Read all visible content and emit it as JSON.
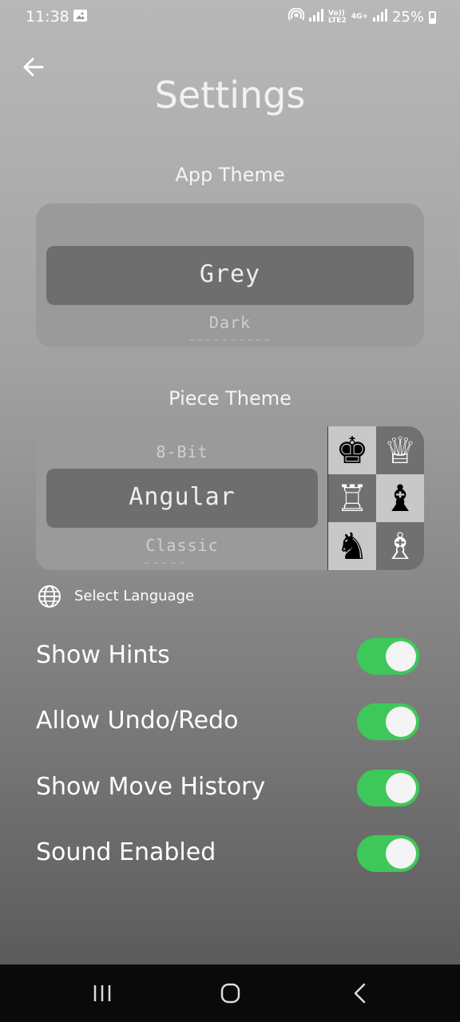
{
  "status_bar": {
    "time": "11:38",
    "network_label_top": "Vo))",
    "network_label_bottom": "LTE2",
    "network_4g": "4G+",
    "battery": "25%"
  },
  "header": {
    "title": "Settings",
    "back_icon": "arrow-left-icon"
  },
  "app_theme": {
    "title": "App Theme",
    "options": [
      "Grey",
      "Dark"
    ],
    "selected": "Grey"
  },
  "piece_theme": {
    "title": "Piece Theme",
    "options": [
      "8-Bit",
      "Angular",
      "Classic"
    ],
    "selected": "Angular",
    "preview_pieces": [
      "♚",
      "♕",
      "♖",
      "♝",
      "♞",
      "♗"
    ]
  },
  "language": {
    "icon": "globe-icon",
    "label": "Select Language"
  },
  "toggles": [
    {
      "label": "Show Hints",
      "on": true
    },
    {
      "label": "Allow Undo/Redo",
      "on": true
    },
    {
      "label": "Show Move History",
      "on": true
    },
    {
      "label": "Sound Enabled",
      "on": true
    }
  ],
  "colors": {
    "toggle_on": "#3ec85a",
    "picker_bg": "#9a9a9a",
    "picker_selected": "#6e6e6e"
  },
  "nav_bar": {
    "recents_icon": "recents-icon",
    "home_icon": "home-icon",
    "back_icon": "back-chevron-icon"
  }
}
